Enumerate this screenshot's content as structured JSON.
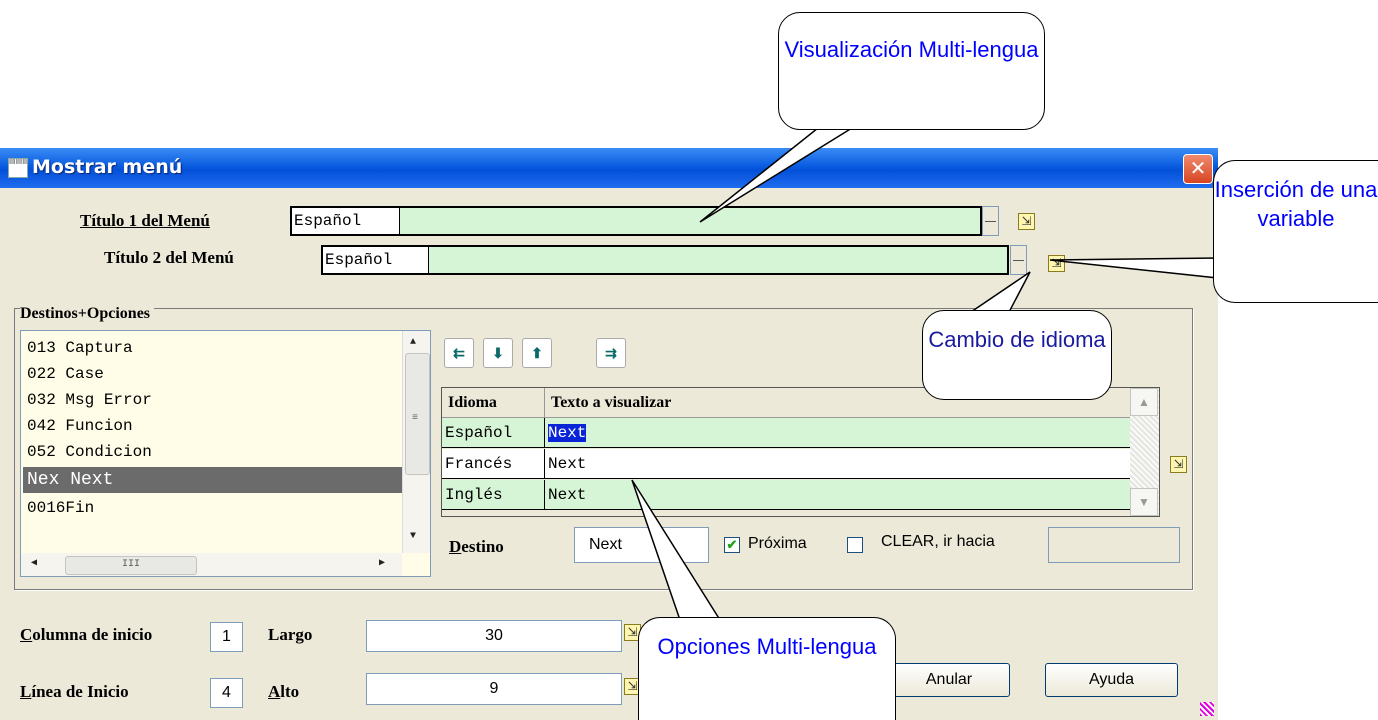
{
  "window": {
    "title": "Mostrar menú",
    "close": "✕"
  },
  "titles": [
    {
      "label": "Título 1 del Menú",
      "lang": "Español",
      "value": ""
    },
    {
      "label": "Título 2 del Menú",
      "lang": "Español",
      "value": ""
    }
  ],
  "destinations": {
    "group_label": "Destinos+Opciones",
    "items": [
      "013 Captura",
      "022 Case",
      "032 Msg Error",
      "042 Funcion",
      "052 Condicion",
      "Nex Next",
      "0016Fin"
    ],
    "selected_index": 5
  },
  "toolbar": {
    "buttons": [
      "insert-row",
      "move-down",
      "move-up",
      "delete-row"
    ]
  },
  "lang_table": {
    "headers": [
      "Idioma",
      "Texto a visualizar"
    ],
    "rows": [
      {
        "lang": "Español",
        "text": "Next"
      },
      {
        "lang": "Francés",
        "text": "Next"
      },
      {
        "lang": "Inglés",
        "text": "Next"
      }
    ]
  },
  "destino": {
    "label": "Destino",
    "value": "Next",
    "proxima_label": "Próxima",
    "proxima_checked": true,
    "clear_label": "CLEAR, ir hacia",
    "clear_checked": false,
    "clear_value": ""
  },
  "position": {
    "col_label": "Columna de inicio",
    "col_value": "1",
    "line_label": "Línea de Inicio",
    "line_value": "4",
    "width_label": "Largo",
    "width_value": "30",
    "height_label": "Alto",
    "height_value": "9"
  },
  "buttons": {
    "cancel": "Anular",
    "help": "Ayuda"
  },
  "callouts": {
    "visual": "Visualización Multi-lengua",
    "insert_var": "Inserción de una variable",
    "lang_change": "Cambio de idioma",
    "options": "Opciones Multi-lengua"
  },
  "colors": {
    "field_bg": "#d6f5d6",
    "list_bg": "#fffde7",
    "titlebar": "#0a5ce0",
    "callout_text": "#0000ff"
  }
}
